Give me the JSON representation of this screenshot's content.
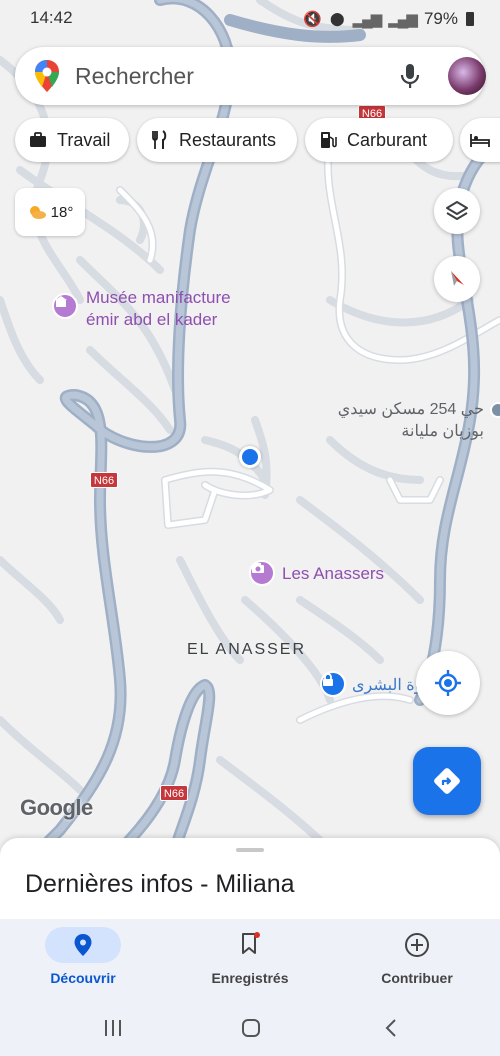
{
  "status_bar": {
    "time": "14:42",
    "battery": "79%"
  },
  "search": {
    "placeholder": "Rechercher"
  },
  "chips": [
    {
      "label": "Travail",
      "icon": "briefcase-icon"
    },
    {
      "label": "Restaurants",
      "icon": "fork-knife-icon"
    },
    {
      "label": "Carburant",
      "icon": "gas-pump-icon"
    }
  ],
  "weather": {
    "temp": "18°",
    "icon": "partly-cloudy-icon"
  },
  "map": {
    "pois": [
      {
        "line1": "Musée manifacture",
        "line2": "émir abd el kader"
      },
      {
        "label": "Les Anassers"
      }
    ],
    "area_label": "EL ANASSER",
    "arabic_label_line1": "حي 254 مسكن سيدي",
    "arabic_label_line2": "بوزيان مليانة",
    "arabic_poi": "وة البشرى",
    "road_shields": [
      "N66",
      "N66",
      "N66"
    ],
    "google_logo": "Google"
  },
  "sheet": {
    "title": "Dernières infos - Miliana"
  },
  "nav": [
    {
      "label": "Découvrir",
      "icon": "location-pin-icon",
      "active": true
    },
    {
      "label": "Enregistrés",
      "icon": "bookmark-icon",
      "active": false
    },
    {
      "label": "Contribuer",
      "icon": "add-circle-icon",
      "active": false
    }
  ],
  "colors": {
    "accent": "#1a73e8",
    "poi_purple": "#8e4fb0",
    "road": "#a3b4c9",
    "shield_red": "#c5373b"
  }
}
